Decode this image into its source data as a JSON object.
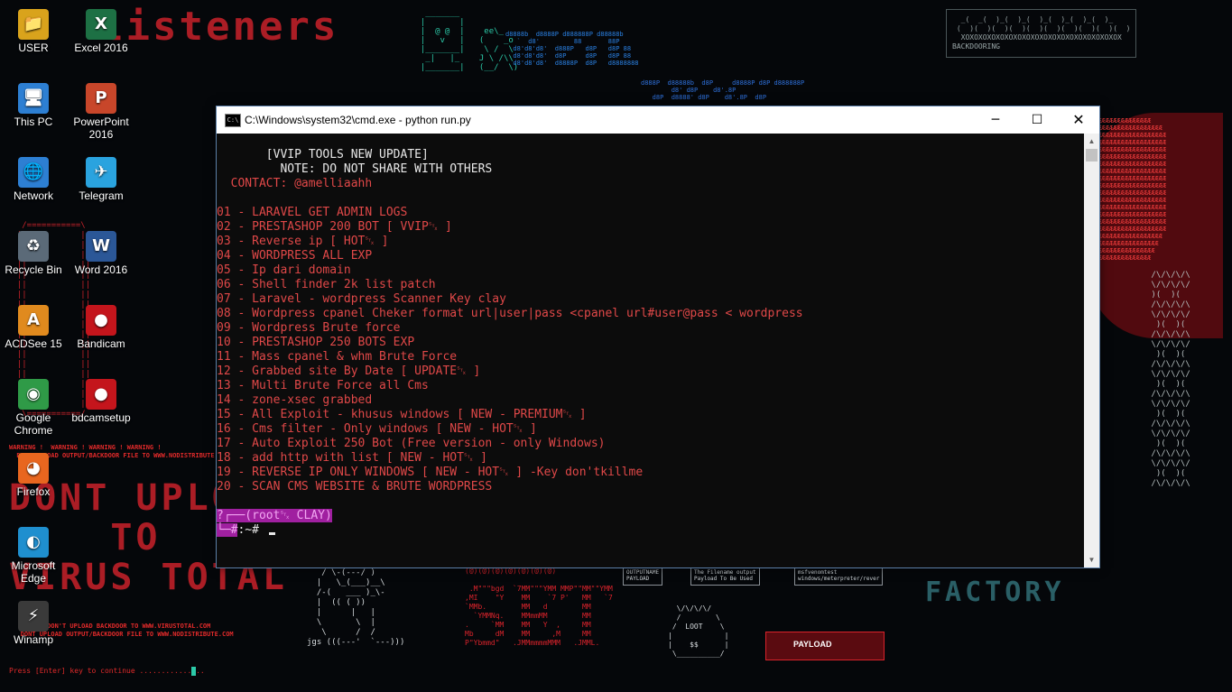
{
  "desktop": {
    "icons": [
      {
        "label": "USER",
        "glyph": "📁",
        "color": "#d9a31c"
      },
      {
        "label": "Excel 2016",
        "glyph": "X",
        "color": "#1d7044"
      },
      {
        "label": "This PC",
        "glyph": "🖥",
        "color": "#2d7fd3"
      },
      {
        "label": "PowerPoint 2016",
        "glyph": "P",
        "color": "#c8462a"
      },
      {
        "label": "Network",
        "glyph": "🌐",
        "color": "#2d7fd3"
      },
      {
        "label": "Telegram",
        "glyph": "✈",
        "color": "#2aa3df"
      },
      {
        "label": "Recycle Bin",
        "glyph": "♻",
        "color": "#5b6a78"
      },
      {
        "label": "Word 2016",
        "glyph": "W",
        "color": "#2b5797"
      },
      {
        "label": "ACDSee 15",
        "glyph": "A",
        "color": "#e08a1e"
      },
      {
        "label": "Bandicam",
        "glyph": "●",
        "color": "#c4151c"
      },
      {
        "label": "Google Chrome",
        "glyph": "◉",
        "color": "#2f9a47"
      },
      {
        "label": "bdcamsetup",
        "glyph": "●",
        "color": "#c4151c"
      },
      {
        "label": "Firefox",
        "glyph": "◕",
        "color": "#e8661f"
      },
      {
        "label": "Microsoft Edge",
        "glyph": "◐",
        "color": "#1f8fcf"
      },
      {
        "label": "Winamp",
        "glyph": "⚡",
        "color": "#3a3a3a"
      }
    ]
  },
  "window": {
    "title": "C:\\Windows\\system32\\cmd.exe - python  run.py",
    "app_icon": "C:\\",
    "minimize_glyph": "─",
    "maximize_glyph": "☐",
    "close_glyph": "✕",
    "scroll_up_glyph": "▲",
    "scroll_down_glyph": "▼"
  },
  "terminal": {
    "header": "       [VVIP TOOLS NEW UPDATE]",
    "note": "         NOTE: DO NOT SHARE WITH OTHERS",
    "contact": "  CONTACT: @amelliaahh",
    "menu": [
      "01 - LARAVEL GET ADMIN LOGS",
      "02 - PRESTASHOP 200 BOT [ VVIP␂ ]",
      "03 - Reverse ip [ HOT␂ ]",
      "04 - WORDPRESS ALL EXP",
      "05 - Ip dari domain",
      "06 - Shell finder 2k list patch",
      "07 - Laravel - wordpress Scanner Key clay",
      "08 - Wordpress cpanel Cheker format url|user|pass <cpanel url#user@pass < wordpress",
      "09 - Wordpress Brute force",
      "10 - PRESTASHOP 250 BOTS EXP",
      "11 - Mass cpanel & whm Brute Force",
      "12 - Grabbed site By Date [ UPDATE␂ ]",
      "13 - Multi Brute Force all Cms",
      "14 - zone-xsec grabbed",
      "15 - All Exploit - khusus windows [ NEW - PREMIUM␂ ]",
      "16 - Cms filter - Only windows [ NEW - HOT␂ ]",
      "17 - Auto Exploit 250 Bot (Free version - only Windows)",
      "18 - add http with list [ NEW - HOT␂ ]",
      "19 - REVERSE IP ONLY WINDOWS [ NEW - HOT␂ ] -Key don'tkillme",
      "20 - SCAN CMS WEBSITE & BRUTE WORDPRESS"
    ],
    "prompt_line1": "?┌──(root␂ CLAY)",
    "prompt_line2_root": "└─#",
    "prompt_line2_rest": ":~# "
  },
  "wallpaper": {
    "title_red": "listeners",
    "warning_top": "WARNING !  WARNING ! WARNING ! WARNING !\n  DONT UPLOAD OUTPUT/BACKDOOR FILE TO WWW.NODISTRIBUTE.COM",
    "dont_upload": "DONT UPLO\n    TO\nVIRUS TOTAL",
    "warning_bottom": "   PLEASE DON'T UPLOAD BACKDOOR TO WWW.VIRUSTOTAL.COM\n   DONT UPLOAD OUTPUT/BACKDOOR FILE TO WWW.NODISTRIBUTE.COM",
    "press_enter": "Press [Enter] key to continue ...............",
    "payload_label": "PAYLOAD",
    "loot_label": "LOOT",
    "box1": "OUTPUTNAME\nPAYLOAD",
    "box2": "The Filename output\nPayload To Be Used",
    "box3": "msfvenomtest\nwindows/meterpreter/rever",
    "bottom_right": "BACKDOOR\nFACTORY",
    "backdooring": "BACKDOORING"
  }
}
